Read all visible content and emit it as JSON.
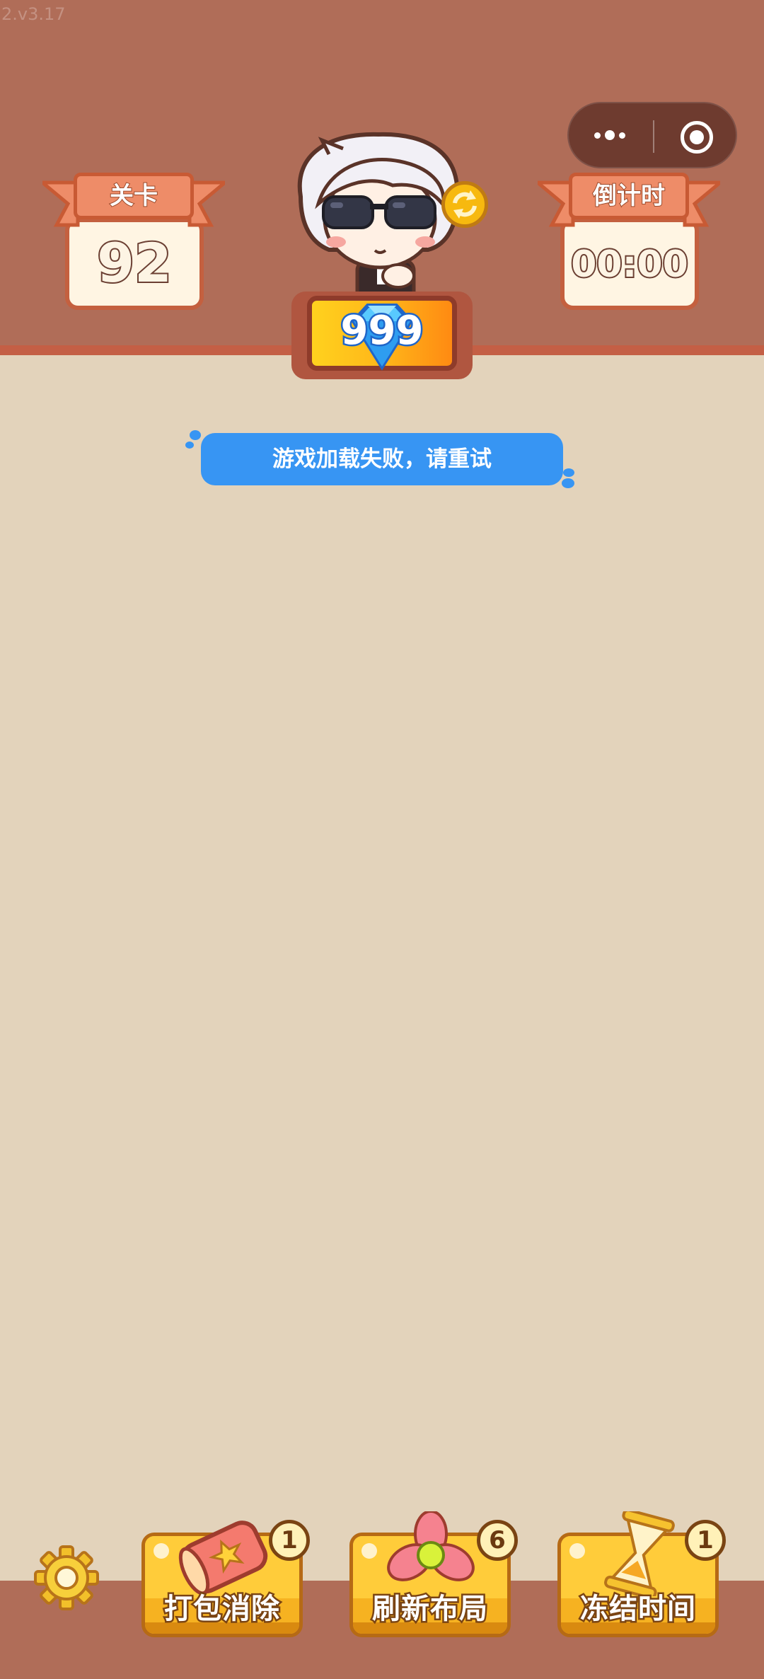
{
  "version": "2.v3.17",
  "header": {
    "level": {
      "label": "关卡",
      "value": "92"
    },
    "countdown": {
      "label": "倒计时",
      "value": "00:00"
    },
    "gems": "999"
  },
  "toast": "游戏加载失败，请重试",
  "tools": [
    {
      "label": "打包消除",
      "count": "1",
      "icon": "package-icon"
    },
    {
      "label": "刷新布局",
      "count": "6",
      "icon": "pinwheel-icon"
    },
    {
      "label": "冻结时间",
      "count": "1",
      "icon": "hourglass-icon"
    }
  ],
  "colors": {
    "header_bg": "#B06D58",
    "board_bg": "#E3D3BB",
    "toast_bg": "#3795F3",
    "tool_bg": "#F6B221"
  }
}
